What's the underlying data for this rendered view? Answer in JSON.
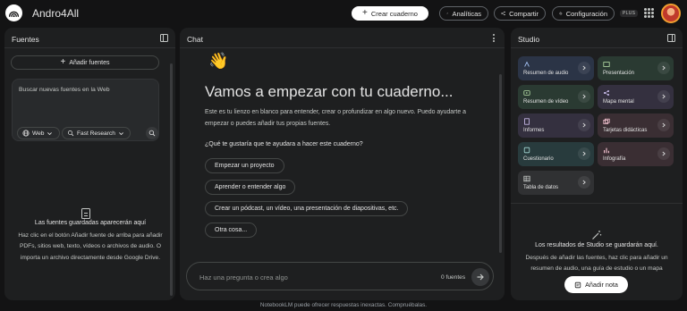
{
  "header": {
    "app_title": "Andro4All",
    "create_label": "Crear cuaderno",
    "analytics_label": "Analíticas",
    "share_label": "Compartir",
    "config_label": "Configuración",
    "plus_badge": "PLUS"
  },
  "sources": {
    "title": "Fuentes",
    "add_label": "Añadir fuentes",
    "search_placeholder": "Buscar nuevas fuentes en la Web",
    "chip_web": "Web",
    "chip_research": "Fast Research",
    "empty_title": "Las fuentes guardadas aparecerán aquí",
    "empty_desc": "Haz clic en el botón Añadir fuente de arriba para añadir PDFs, sitios web, texto, vídeos o archivos de audio. O importa un archivo directamente desde Google Drive."
  },
  "chat": {
    "title": "Chat",
    "wave": "👋",
    "headline": "Vamos a empezar con tu cuaderno...",
    "intro": "Este es tu lienzo en blanco para entender, crear o profundizar en algo nuevo. Puedo ayudarte a empezar o puedes añadir tus propias fuentes.",
    "question": "¿Qué te gustaría que te ayudara a hacer este cuaderno?",
    "suggestions": [
      "Empezar un proyecto",
      "Aprender o entender algo",
      "Crear un pódcast, un vídeo, una presentación de diapositivas, etc.",
      "Otra cosa..."
    ],
    "input_placeholder": "Haz una pregunta o crea algo",
    "source_count": "0 fuentes"
  },
  "studio": {
    "title": "Studio",
    "tiles": [
      {
        "label": "Resumen de audio"
      },
      {
        "label": "Presentación"
      },
      {
        "label": "Resumen de vídeo"
      },
      {
        "label": "Mapa mental"
      },
      {
        "label": "Informes"
      },
      {
        "label": "Tarjetas didácticas"
      },
      {
        "label": "Cuestionario"
      },
      {
        "label": "Infografía"
      },
      {
        "label": "Tabla de datos"
      }
    ],
    "empty_title": "Los resultados de Studio se guardarán aquí.",
    "empty_desc": "Después de añadir las fuentes, haz clic para añadir un resumen de audio, una guía de estudio o un mapa",
    "add_note_label": "Añadir nota"
  },
  "footer": {
    "disclaimer": "NotebookLM puede ofrecer respuestas inexactas. Compruébalas."
  },
  "colors": {
    "background": "#131314",
    "panel": "#1e1f20",
    "text": "#e3e3e3"
  }
}
